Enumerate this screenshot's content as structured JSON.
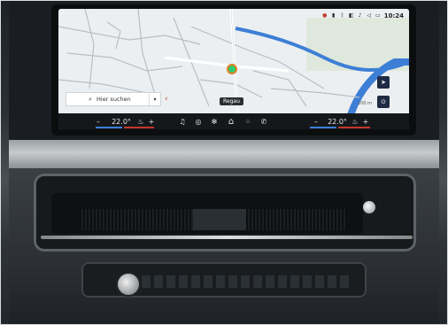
{
  "status_bar": {
    "time": "10:24",
    "icons": [
      "record-icon",
      "phone-icon",
      "bluetooth-icon",
      "car-icon",
      "music-icon",
      "mute-icon",
      "battery-icon"
    ]
  },
  "map": {
    "search_placeholder": "Hier suchen",
    "location_label": "Regau",
    "scale_label": "100 m"
  },
  "climate": {
    "left_temp": "22.0°",
    "right_temp": "22.0°",
    "minus": "–",
    "plus": "+"
  },
  "colors": {
    "accent_blue": "#1f2a44",
    "accent_red": "#c0392b",
    "map_water": "#3d7fd6",
    "map_road": "#ffffff"
  }
}
